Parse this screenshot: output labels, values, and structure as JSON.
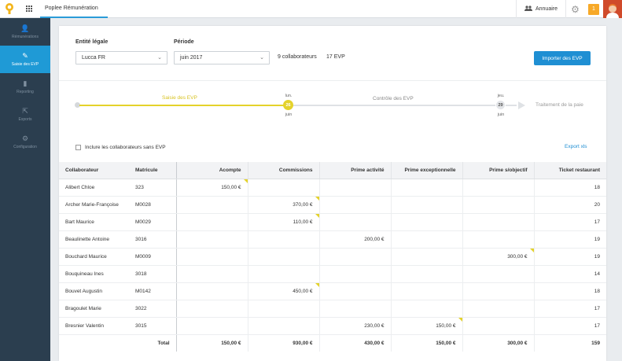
{
  "header": {
    "app_title": "Poplee Rémunération",
    "annuaire": "Annuaire",
    "notif_count": "1",
    "accent": "#2a9bd8"
  },
  "sidebar": {
    "items": [
      {
        "label": "Rémunérations",
        "icon": "person-icon",
        "glyph": "👤"
      },
      {
        "label": "Saisie des EVP",
        "icon": "edit-icon",
        "glyph": "✎",
        "active": true
      },
      {
        "label": "Reporting",
        "icon": "bar-chart-icon",
        "glyph": "▮"
      },
      {
        "label": "Exports",
        "icon": "export-icon",
        "glyph": "⇱"
      },
      {
        "label": "Configuration",
        "icon": "gear-icon",
        "glyph": "⚙"
      }
    ]
  },
  "filters": {
    "entity_label": "Entité légale",
    "entity_value": "Lucca FR",
    "period_label": "Période",
    "period_value": "juin 2017",
    "collab_count": "9 collaborateurs",
    "evp_count": "17 EVP",
    "import_button": "Importer des EVP"
  },
  "timeline": {
    "step1": "Saisie des EVP",
    "date1_day": "lun.",
    "date1_num": "26",
    "date1_month": "juin",
    "step2": "Contrôle des EVP",
    "date2_day": "jeu.",
    "date2_num": "29",
    "date2_month": "juin",
    "step3": "Traitement de la paie",
    "active_color": "#e4d22b"
  },
  "options": {
    "include_label": "Inclure les collaborateurs sans EVP",
    "export_label": "Export xls"
  },
  "table": {
    "headers": [
      "Collaborateur",
      "Matricule",
      "Acompte",
      "Commissions",
      "Prime activité",
      "Prime exceptionnelle",
      "Prime s/objectif",
      "Ticket restaurant"
    ],
    "rows": [
      {
        "name": "Alibert Chloe",
        "mat": "323",
        "vals": [
          "150,00 €",
          "",
          "",
          "",
          "",
          "18"
        ],
        "flags": [
          0
        ]
      },
      {
        "name": "Archer Marie-Françoise",
        "mat": "M0028",
        "vals": [
          "",
          "370,00 €",
          "",
          "",
          "",
          "20"
        ],
        "flags": [
          1
        ]
      },
      {
        "name": "Bart Maurice",
        "mat": "M0029",
        "vals": [
          "",
          "110,00 €",
          "",
          "",
          "",
          "17"
        ],
        "flags": [
          1
        ]
      },
      {
        "name": "Beaulinette Antoine",
        "mat": "3016",
        "vals": [
          "",
          "",
          "200,00 €",
          "",
          "",
          "19"
        ],
        "flags": []
      },
      {
        "name": "Bouchard Maurice",
        "mat": "M0009",
        "vals": [
          "",
          "",
          "",
          "",
          "300,00 €",
          "19"
        ],
        "flags": [
          4
        ]
      },
      {
        "name": "Bouquineau Ines",
        "mat": "3018",
        "vals": [
          "",
          "",
          "",
          "",
          "",
          "14"
        ],
        "flags": []
      },
      {
        "name": "Bouvet Augustin",
        "mat": "M0142",
        "vals": [
          "",
          "450,00 €",
          "",
          "",
          "",
          "18"
        ],
        "flags": [
          1
        ]
      },
      {
        "name": "Bragoulet Marie",
        "mat": "3022",
        "vals": [
          "",
          "",
          "",
          "",
          "",
          "17"
        ],
        "flags": []
      },
      {
        "name": "Bresnier Valentin",
        "mat": "3015",
        "vals": [
          "",
          "",
          "230,00 €",
          "150,00 €",
          "",
          "17"
        ],
        "flags": [
          3
        ]
      }
    ],
    "total_label": "Total",
    "totals": [
      "150,00 €",
      "930,00 €",
      "430,00 €",
      "150,00 €",
      "300,00 €",
      "159"
    ]
  }
}
